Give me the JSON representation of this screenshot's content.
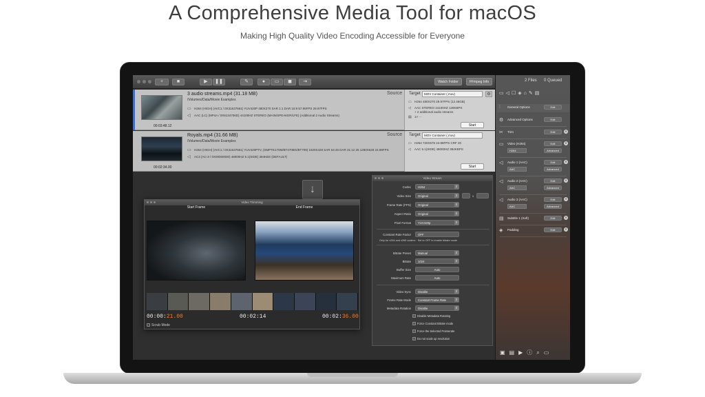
{
  "hero": {
    "title": "A Comprehensive Media Tool for macOS",
    "subtitle": "Making High Quality Video Encoding Accessible for Everyone"
  },
  "toolbar": {
    "add": "+",
    "stop": "■",
    "play": "▶",
    "pause": "❚❚",
    "watch_folder": "Watch Folder",
    "ffmpeg_info": "FFmpeg Info"
  },
  "queue": {
    "items": [
      {
        "name": "3 audio streams.mp4  (31.18 MB)",
        "path": "/Volumes/Data/Movie Examples",
        "duration": "00:03:48.12",
        "video_stream": "H264 (HIGH) (AVC1 / 0X31637661)  YUV420P 480X270 SAR 1:1 DAR 16:9 57.95FPS 29.97FPS",
        "audio_stream": "AAC (LC) (MP4A / 0X6134706D)  44100HZ STEREO (MAIN/SPEAKER/LFE) (Additional 2 Audio Streams)",
        "source_label": "Source",
        "target_label": "Target",
        "target_format": "MOV Container (.mov)",
        "target_video": "H264 480X270 29.97FPS (12.46GB)",
        "target_audio": "AAC STEREO 44100HZ 128KBPS",
        "target_audio_extra": "+ 2 additional audio streams",
        "target_extra": "1× ···",
        "start": "Start"
      },
      {
        "name": "Royals.mp4  (31.66 MB)",
        "path": "/Volumes/Data/Movie Examples",
        "duration": "00:02:34.00",
        "video_stream": "H264 (HIGH) (AVC1 / 0X31637661)  YUV420PTV, (SMPTE170M/BT470BG/BT709) 1920X428 SAR 64:45 DAR 31:12 25 1280X628 24.98FPS",
        "audio_stream": "AC3 (AC-3 / 0X00000000)  48000HZ 5.1(SIDE) 384KBS (DEFAULT)",
        "source_label": "Source",
        "target_label": "Target",
        "target_format": "MOV Container (.mov)",
        "target_video": "H264 720X576 24.98FPS CRF 20",
        "target_audio": "AAC 5.1(SIDE) 48000HZ 384KBPS",
        "start": "Start"
      }
    ]
  },
  "trim_window": {
    "title": "Video Trimming",
    "start_label": "Start Frame",
    "end_label": "End Frame",
    "start_tc_prefix": "00:00:",
    "start_tc_accent": "21.00",
    "mid_tc": "00:02:14",
    "end_tc_prefix": "00:02:",
    "end_tc_accent": "36.00",
    "scrub_mode": "Scrub Mode"
  },
  "video_stream": {
    "title": "Video Stream",
    "codec_label": "Codec",
    "codec": "H264",
    "video_size_label": "Video Size",
    "video_size": "Original",
    "size_x": "x",
    "frame_rate_label": "Frame Rate (FPS)",
    "frame_rate": "Original",
    "aspect_label": "Aspect Ratio",
    "aspect": "Original",
    "pixel_label": "Pixel Format",
    "pixel": "YUV420p",
    "crf_label": "Constant Rate Factor",
    "crf": "OFF",
    "crf_note": "Only for x264 and x265 codecs  ·  Set to OFF to enable bitrate mode",
    "bitrate_preset_label": "Bitrate Preset",
    "bitrate_preset": "Manual",
    "bitrate_label": "Bitrate",
    "bitrate": "1024",
    "buffer_label": "Buffer Size",
    "buffer": "Auto",
    "maxrate_label": "Maximum Rate",
    "maxrate": "Auto",
    "vsync_label": "Video Sync",
    "vsync": "Disable",
    "frm_label": "Frame Rate Mode",
    "frm": "Constant Frame Rate",
    "meta_label": "Metadata Rotation",
    "meta": "Disable",
    "check1": "Disable Metadata Rotating",
    "check2": "Force Constant Bitrate mode",
    "check3": "Force the Selected Framerate",
    "check4": "Do not scale up resolution"
  },
  "sidebar": {
    "files": "2 Files",
    "queued": "0 Queued",
    "general": "General Options",
    "advanced": "Advanced Options",
    "trim": "Trim",
    "video": "Video (H264)",
    "video_codec": "H264",
    "audio1": "Audio 1 (AAC)",
    "audio2": "Audio 2 (AAC)",
    "audio3": "Audio 3 (AAC)",
    "aac": "AAC",
    "subtitle": "Subtitle 1 (Soft)",
    "padding": "Padding",
    "edit": "Edit",
    "adv": "Advanced"
  },
  "colors": {
    "accent_orange": "#f47c2e",
    "selection_blue": "#3a6fd8"
  }
}
